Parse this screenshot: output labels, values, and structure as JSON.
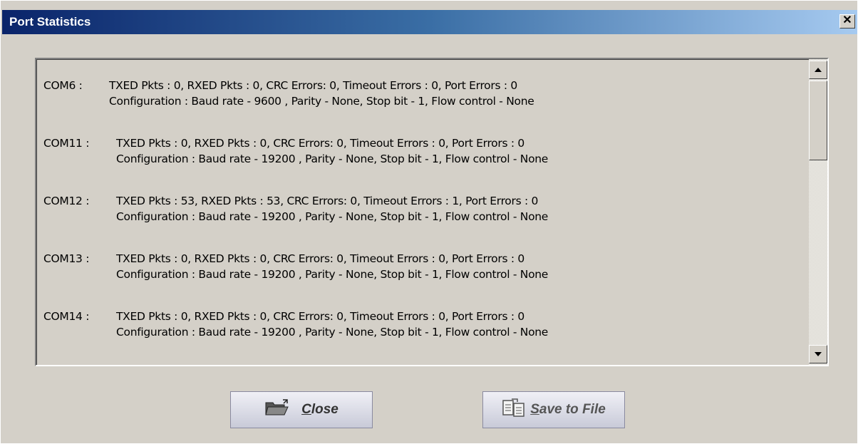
{
  "window": {
    "title": "Port Statistics",
    "close_glyph": "✕"
  },
  "ports": [
    {
      "name": "COM6 :",
      "stats": "TXED Pkts : 0,  RXED Pkts : 0,  CRC Errors: 0, Timeout Errors : 0,  Port Errors : 0",
      "config": "Configuration : Baud rate - 9600 , Parity - None, Stop bit - 1, Flow control - None"
    },
    {
      "name": "COM11 :",
      "stats": "TXED Pkts : 0,  RXED Pkts : 0,  CRC Errors: 0, Timeout Errors : 0,  Port Errors : 0",
      "config": "Configuration : Baud rate - 19200 , Parity - None, Stop bit - 1, Flow control - None"
    },
    {
      "name": "COM12 :",
      "stats": "TXED Pkts : 53,  RXED Pkts : 53,  CRC Errors: 0, Timeout Errors : 1,  Port Errors : 0",
      "config": "Configuration : Baud rate - 19200 , Parity - None, Stop bit - 1, Flow control - None"
    },
    {
      "name": "COM13 :",
      "stats": "TXED Pkts : 0,  RXED Pkts : 0,  CRC Errors: 0, Timeout Errors : 0,  Port Errors : 0",
      "config": "Configuration : Baud rate - 19200 , Parity - None, Stop bit - 1, Flow control - None"
    },
    {
      "name": "COM14 :",
      "stats": "TXED Pkts : 0,  RXED Pkts : 0,  CRC Errors: 0, Timeout Errors : 0,  Port Errors : 0",
      "config": "Configuration : Baud rate - 19200 , Parity - None, Stop bit - 1, Flow control - None"
    }
  ],
  "buttons": {
    "close": {
      "accel": "C",
      "rest": "lose",
      "icon": "folder-open-icon"
    },
    "save": {
      "accel": "S",
      "rest": "ave to File",
      "icon": "save-file-icon"
    }
  },
  "scrollbar": {
    "up_icon": "arrow-up-icon",
    "down_icon": "arrow-down-icon"
  }
}
